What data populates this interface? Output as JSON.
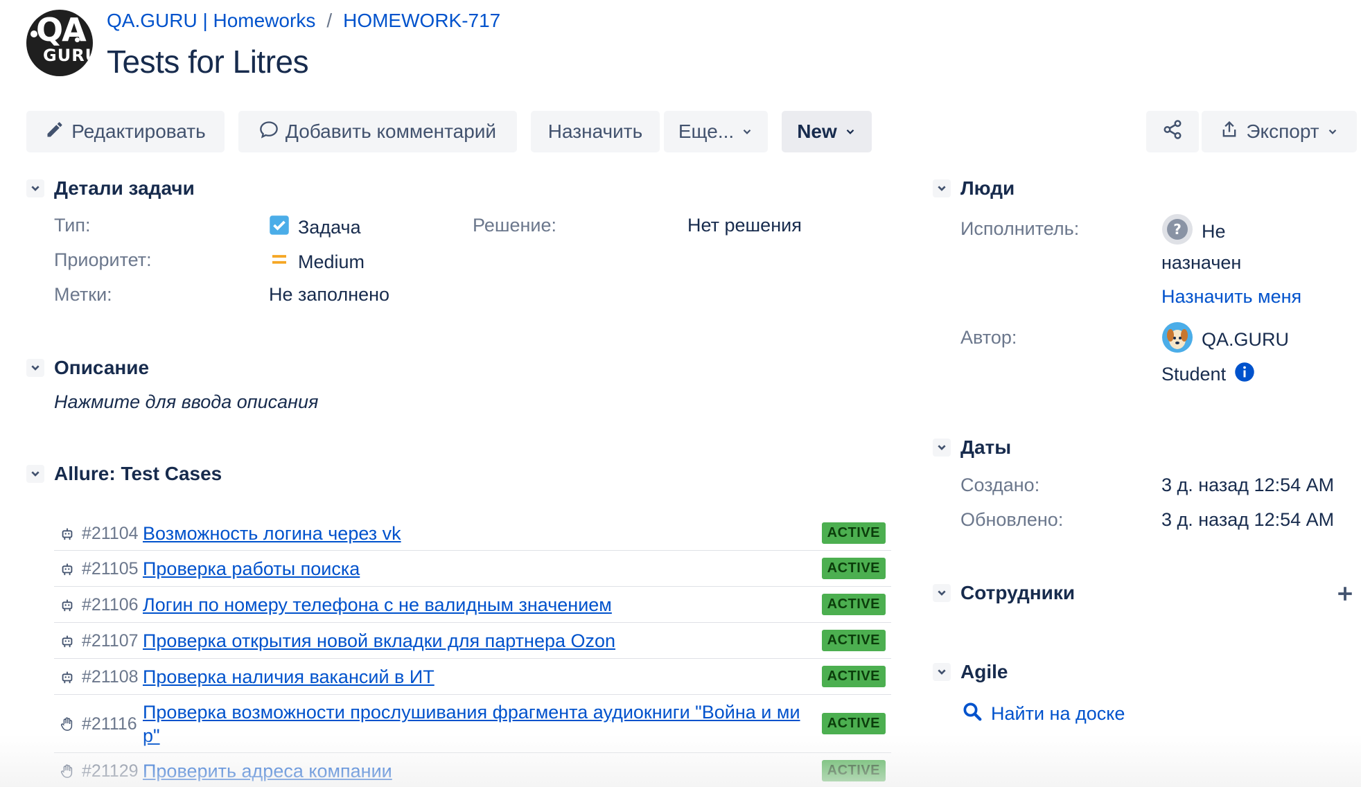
{
  "breadcrumb": {
    "project": "QA.GURU | Homeworks",
    "separator": "/",
    "issue_key": "HOMEWORK-717"
  },
  "logo": {
    "top": "QA",
    "bottom": "GURU"
  },
  "title": "Tests for Litres",
  "toolbar": {
    "edit": "Редактировать",
    "comment": "Добавить комментарий",
    "assign": "Назначить",
    "more": "Еще...",
    "status": "New",
    "export": "Экспорт"
  },
  "details": {
    "heading": "Детали задачи",
    "type_label": "Тип:",
    "type_value": "Задача",
    "priority_label": "Приоритет:",
    "priority_value": "Medium",
    "labels_label": "Метки:",
    "labels_value": "Не заполнено",
    "resolution_label": "Решение:",
    "resolution_value": "Нет решения"
  },
  "description": {
    "heading": "Описание",
    "placeholder": "Нажмите для ввода описания"
  },
  "allure": {
    "heading": "Allure: Test Cases",
    "cases": [
      {
        "icon": "robot-icon",
        "id": "#21104",
        "title": "Возможность логина через vk",
        "status": "ACTIVE"
      },
      {
        "icon": "robot-icon",
        "id": "#21105",
        "title": "Проверка работы поиска",
        "status": "ACTIVE"
      },
      {
        "icon": "robot-icon",
        "id": "#21106",
        "title": "Логин по номеру телефона с не валидным значением",
        "status": "ACTIVE"
      },
      {
        "icon": "robot-icon",
        "id": "#21107",
        "title": "Проверка открытия новой вкладки для партнера Ozon",
        "status": "ACTIVE"
      },
      {
        "icon": "robot-icon",
        "id": "#21108",
        "title": "Проверка наличия вакансий в ИТ",
        "status": "ACTIVE"
      },
      {
        "icon": "hand-icon",
        "id": "#21116",
        "title": "Проверка возможности прослушивания фрагмента аудиокниги \"Война и ми р\"",
        "status": "ACTIVE"
      },
      {
        "icon": "hand-icon",
        "id": "#21129",
        "title": "Проверить адреса компании",
        "status": "ACTIVE"
      }
    ]
  },
  "people": {
    "heading": "Люди",
    "assignee_label": "Исполнитель:",
    "assignee_value_1": "Не",
    "assignee_value_2": "назначен",
    "assign_me": "Назначить меня",
    "reporter_label": "Автор:",
    "reporter_value_1": "QA.GURU",
    "reporter_value_2": "Student"
  },
  "dates": {
    "heading": "Даты",
    "created_label": "Создано:",
    "created_value": "3 д. назад 12:54 AM",
    "updated_label": "Обновлено:",
    "updated_value": "3 д. назад 12:54 AM"
  },
  "employees": {
    "heading": "Сотрудники"
  },
  "agile": {
    "heading": "Agile",
    "find_on_board": "Найти на доске"
  },
  "colors": {
    "link": "#0052cc",
    "text": "#172b4d",
    "muted": "#6b778c",
    "active_badge": "#4caf50",
    "priority": "#f5a623"
  }
}
